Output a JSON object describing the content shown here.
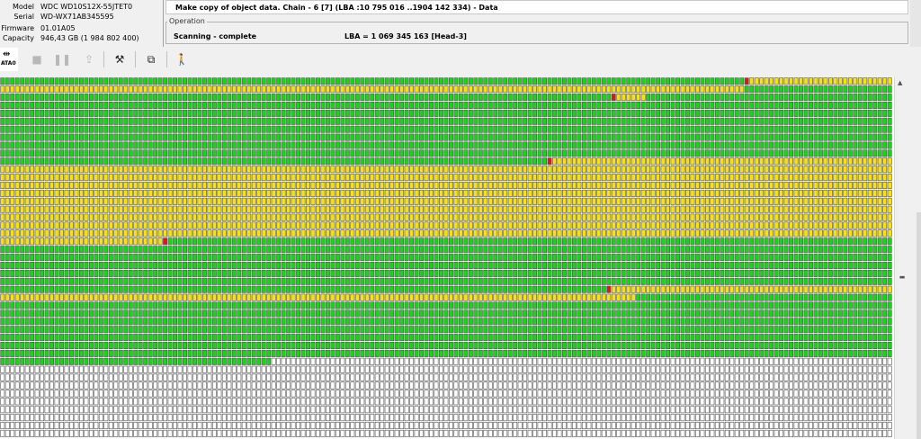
{
  "drive": {
    "model_label": "Model",
    "model": "WDC WD10S12X-55JTET0",
    "serial_label": "Serial",
    "serial": "WD-WX71AB345595",
    "firmware_label": "Firmware",
    "firmware": "01.01A05",
    "capacity_label": "Capacity",
    "capacity": "946,43 GB (1 984 802 400)"
  },
  "task_title": "Make copy of object data. Chain - 6 [7] (LBA :10 795 016 ..1904 142 334) - Data",
  "operation": {
    "legend": "Operation",
    "status": "Scanning - complete",
    "lba_text": "LBA =    1 069 345 163  [Head-3]"
  },
  "toolbar": {
    "port_label": "ATA0",
    "icons": [
      "ata-port-icon",
      "stop-icon",
      "pause-icon",
      "export-icon",
      "tools-icon",
      "copy-windows-icon",
      "exit-icon"
    ]
  },
  "colors": {
    "good": "#1bd31b",
    "slow": "#f5e11a",
    "error": "#d81a1a",
    "unread": "#ffffff",
    "cell_border": "#505050"
  },
  "sector_map": {
    "columns": 181,
    "rows": 45,
    "segments": [
      [
        "G",
        151
      ],
      [
        "E",
        1
      ],
      [
        "Y",
        180
      ],
      [
        "G",
        154
      ],
      [
        "E",
        1
      ],
      [
        "Y",
        6
      ],
      [
        "G",
        1428
      ],
      [
        "E",
        1
      ],
      [
        "Y",
        1731
      ],
      [
        "E",
        1
      ],
      [
        "G",
        1175
      ],
      [
        "E",
        1
      ],
      [
        "Y",
        186
      ],
      [
        "G",
        1374
      ],
      [
        "U",
        131
      ]
    ]
  }
}
